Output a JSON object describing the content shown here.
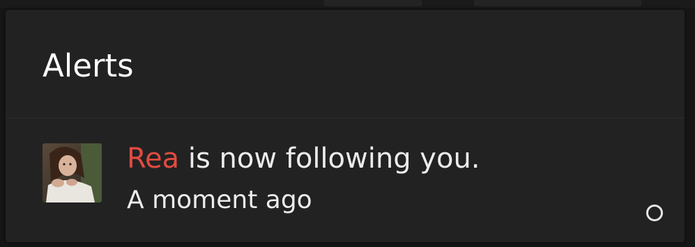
{
  "alerts_panel": {
    "title": "Alerts",
    "items": [
      {
        "username": "Rea",
        "message_rest": " is now following you.",
        "time": "A moment ago",
        "avatar": "user-avatar-photo",
        "status_icon": "unread-circle-icon"
      }
    ]
  },
  "colors": {
    "panel_bg": "#222222",
    "username": "#e14b41",
    "text": "#ececec"
  }
}
